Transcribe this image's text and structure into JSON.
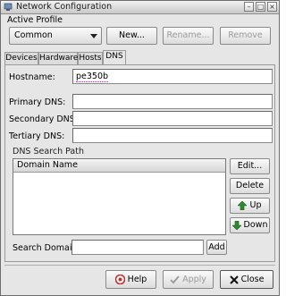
{
  "window": {
    "title": "Network Configuration"
  },
  "profile": {
    "group_label": "Active Profile",
    "current": "Common",
    "new_label": "New...",
    "rename_label": "Rename...",
    "remove_label": "Remove"
  },
  "tabs": [
    {
      "label": "Devices"
    },
    {
      "label": "Hardware"
    },
    {
      "label": "Hosts"
    },
    {
      "label": "DNS"
    }
  ],
  "dns": {
    "hostname_label": "Hostname:",
    "hostname_value": "pe350b",
    "primary_label": "Primary DNS:",
    "primary_value": "",
    "secondary_label": "Secondary DNS:",
    "secondary_value": "",
    "tertiary_label": "Tertiary DNS:",
    "tertiary_value": "",
    "search_path_label": "DNS Search Path",
    "column_header": "Domain Name",
    "edit_label": "Edit...",
    "delete_label": "Delete",
    "up_label": "Up",
    "down_label": "Down",
    "search_domain_label": "Search Domain:",
    "search_domain_value": "",
    "add_label": "Add"
  },
  "footer": {
    "help_label": "Help",
    "apply_label": "Apply",
    "close_label": "Close"
  },
  "colors": {
    "accent_underline": "#e000e0",
    "up_arrow": "#2f8a2f",
    "down_arrow": "#2f8a2f",
    "help_icon": "#c03030",
    "close_icon": "#111111"
  },
  "icons": [
    "network-icon",
    "minimize-icon",
    "maximize-icon",
    "close-icon",
    "dropdown-arrow-icon",
    "up-arrow-icon",
    "down-arrow-icon",
    "help-icon",
    "apply-check-icon",
    "close-x-icon"
  ]
}
